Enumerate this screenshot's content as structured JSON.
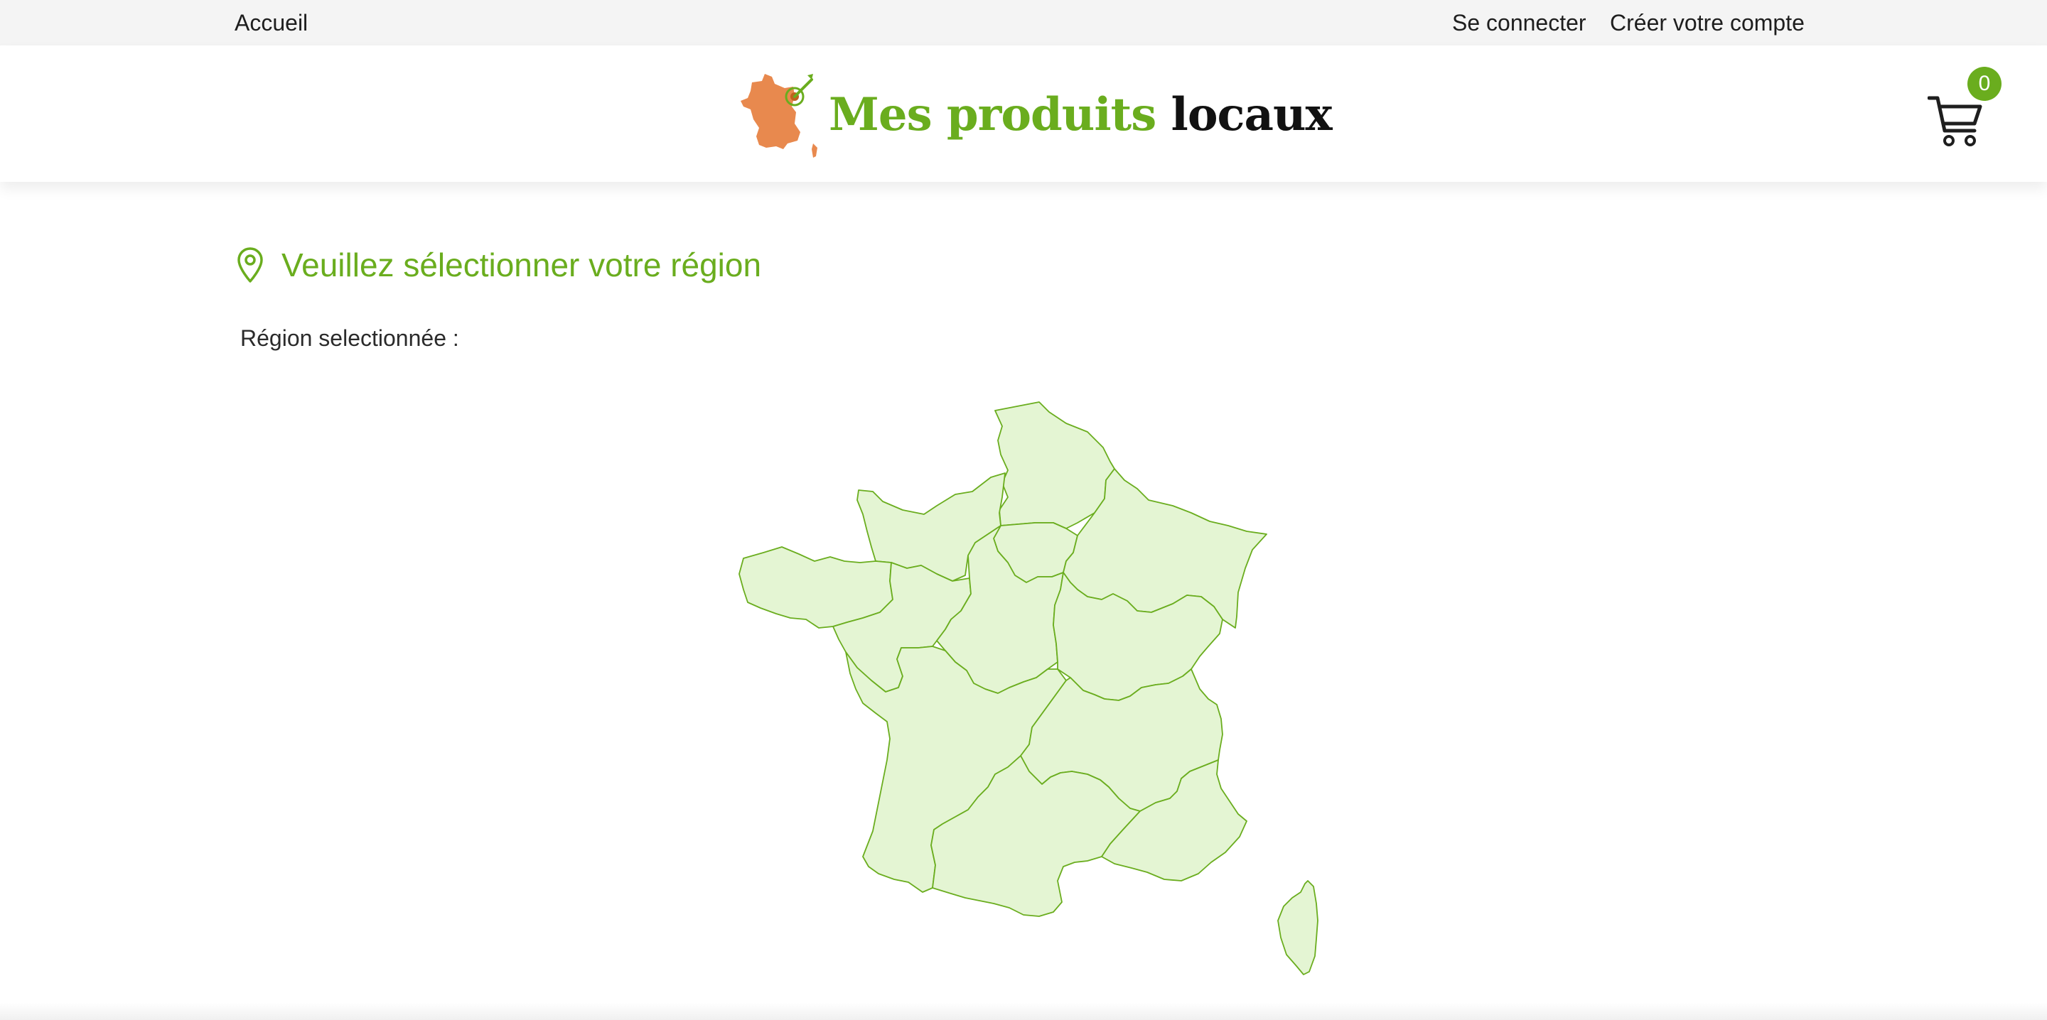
{
  "topbar": {
    "home": "Accueil",
    "login": "Se connecter",
    "signup": "Créer votre compte"
  },
  "header": {
    "logo_text_green": "Mes produits",
    "logo_text_dark": "locaux",
    "cart_count": "0",
    "cart_icon": "shopping-cart-icon"
  },
  "main": {
    "title": "Veuillez sélectionner votre région",
    "title_icon": "map-pin-icon",
    "selected_label": "Région selectionnée :",
    "selected_value": ""
  },
  "colors": {
    "accent": "#6aad1e",
    "region_fill": "#e4f5d3",
    "logo_france": "#e8894e",
    "topbar_bg": "#f4f4f4"
  }
}
